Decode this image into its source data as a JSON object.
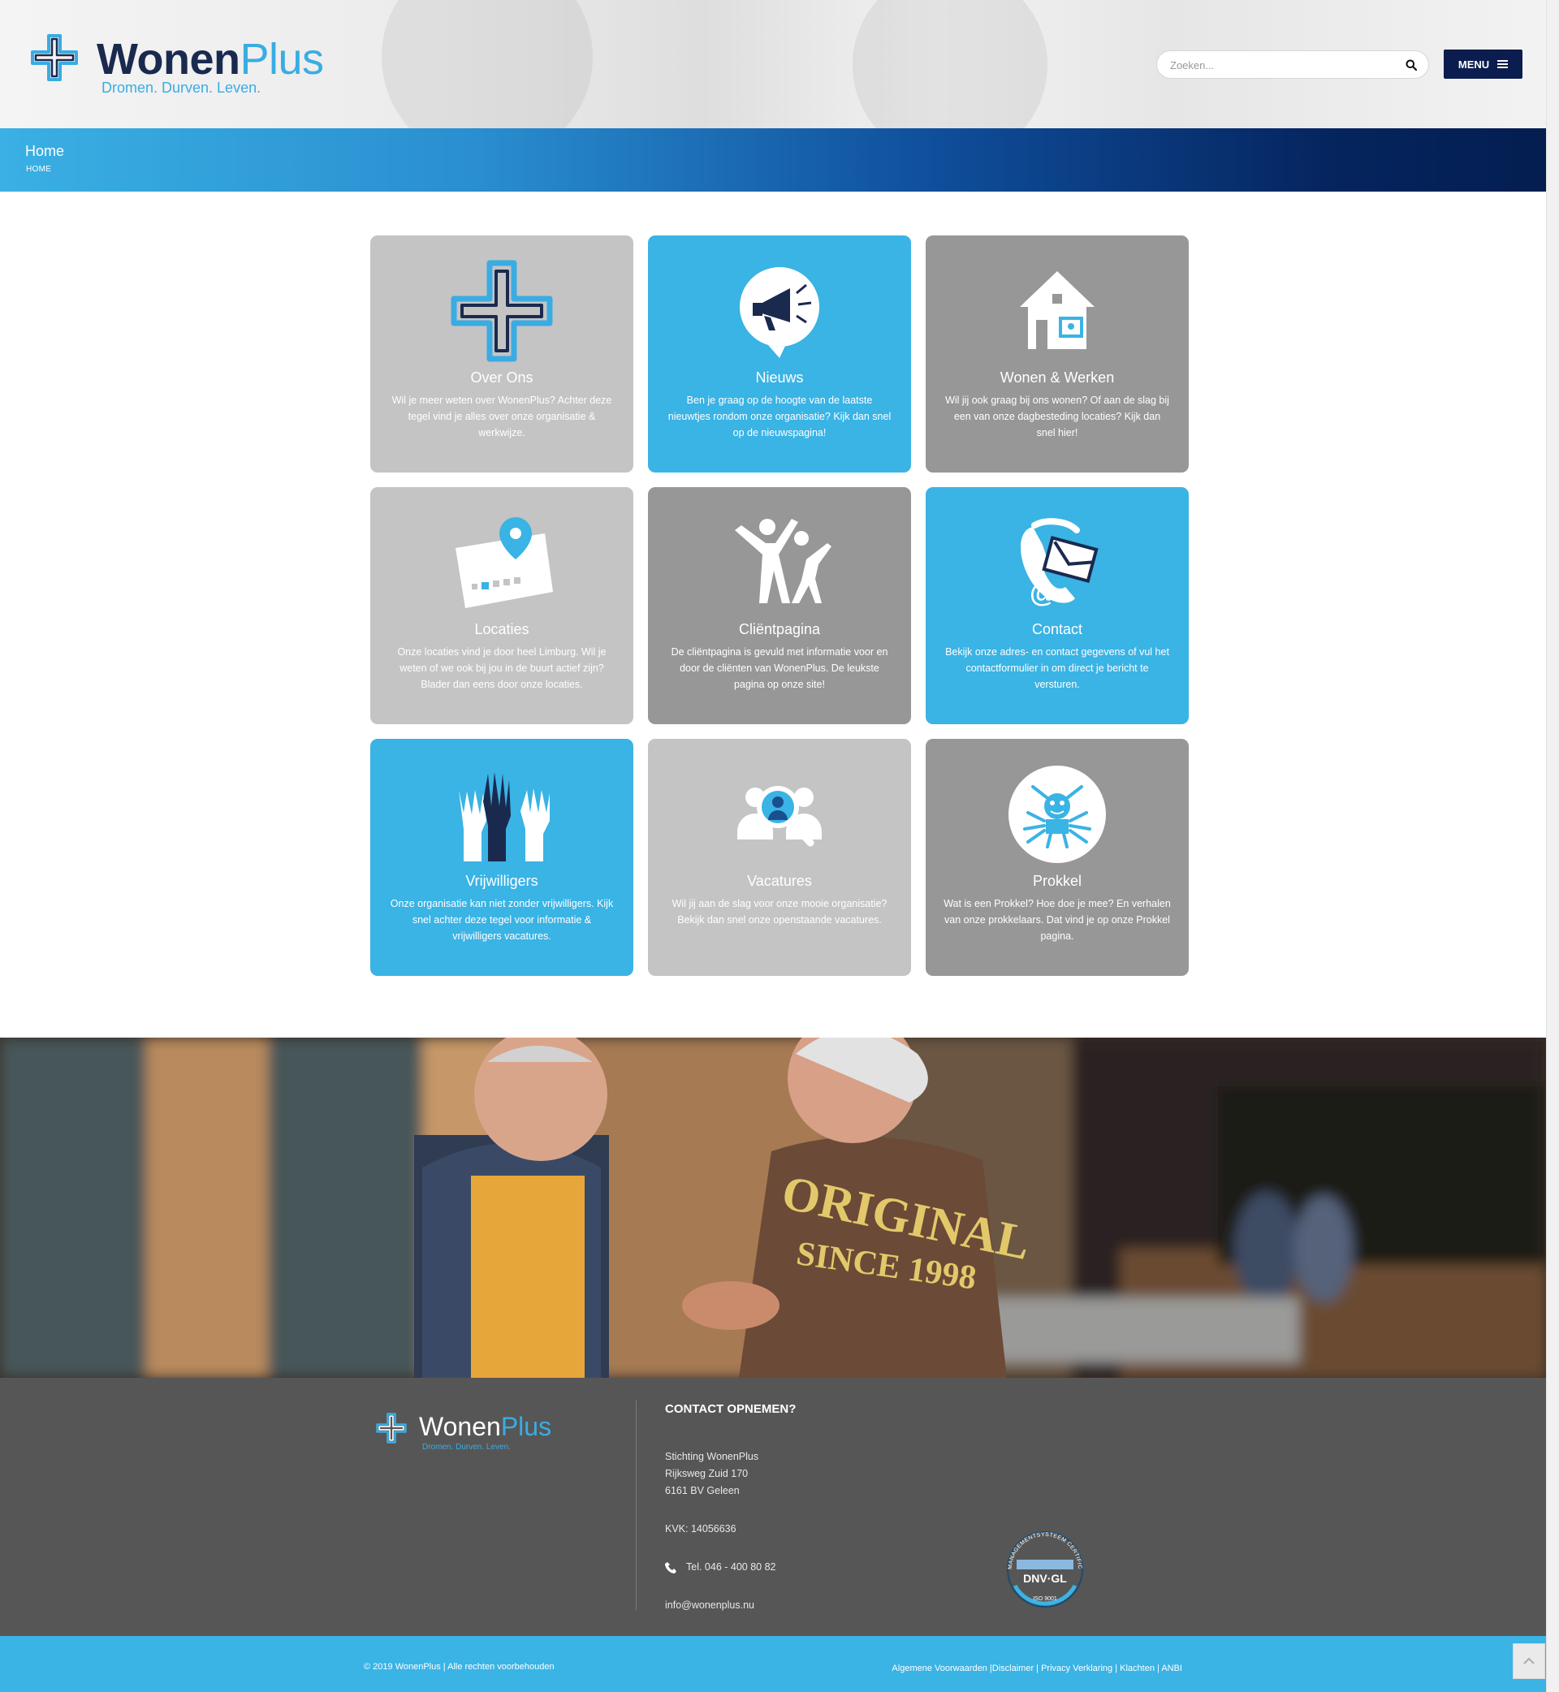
{
  "brand": {
    "name_a": "Wonen",
    "name_b": "Plus",
    "tagline": "Dromen. Durven. Leven."
  },
  "header": {
    "search_placeholder": "Zoeken...",
    "menu_label": "MENU"
  },
  "banner": {
    "title": "Home",
    "breadcrumb": "HOME"
  },
  "tiles": [
    {
      "title": "Over Ons",
      "desc": "Wil je meer weten over WonenPlus? Achter deze tegel vind je alles over onze organisatie & werkwijze.",
      "icon": "cross-logo-icon"
    },
    {
      "title": "Nieuws",
      "desc": "Ben je graag op de hoogte van de laatste nieuwtjes rondom onze organisatie? Kijk dan snel op de nieuwspagina!",
      "icon": "megaphone-icon"
    },
    {
      "title": "Wonen & Werken",
      "desc": "Wil jij ook graag bij ons wonen? Of aan de slag bij een van onze dagbesteding locaties? Kijk dan snel hier!",
      "icon": "house-icon"
    },
    {
      "title": "Locaties",
      "desc": "Onze locaties vind je door heel Limburg. Wil je weten of we ook bij jou in de buurt actief zijn? Blader dan eens door onze locaties.",
      "icon": "map-pin-icon"
    },
    {
      "title": "Cliëntpagina",
      "desc": "De cliëntpagina is gevuld met informatie voor en door de cliënten van WonenPlus. De leukste pagina op onze site!",
      "icon": "people-cheering-icon"
    },
    {
      "title": "Contact",
      "desc": "Bekijk onze adres- en contact gegevens of vul het contactformulier in om direct je bericht te versturen.",
      "icon": "phone-mail-icon"
    },
    {
      "title": "Vrijwilligers",
      "desc": "Onze organisatie kan niet zonder vrijwilligers. Kijk snel achter deze tegel voor informatie & vrijwilligers vacatures.",
      "icon": "raised-hands-icon"
    },
    {
      "title": "Vacatures",
      "desc": "Wil jij aan de slag voor onze mooie organisatie? Bekijk dan snel onze openstaande vacatures.",
      "icon": "magnifier-people-icon"
    },
    {
      "title": "Prokkel",
      "desc": "Wat is een Prokkel? Hoe doe je mee? En verhalen van onze prokkelaars. Dat vind je op onze Prokkel pagina.",
      "icon": "prokkel-frog-icon"
    }
  ],
  "footer": {
    "contact_heading": "CONTACT OPNEMEN?",
    "org": "Stichting WonenPlus",
    "street": "Rijksweg Zuid 170",
    "city": "6161 BV Geleen",
    "kvk": "KVK: 14056636",
    "tel": "Tel. 046 - 400 80 82",
    "email": "info@wonenplus.nu",
    "cert_top": "MANAGEMENTSYSTEEM CERTIFICATE",
    "cert_mid": "DNV·GL",
    "cert_bottom": "ISO 9001"
  },
  "bottom": {
    "copyright": "© 2019 WonenPlus | Alle rechten voorbehouden",
    "links": [
      "Algemene Voorwaarden",
      "Disclaimer",
      "Privacy Verklaring",
      "Klachten",
      "ANBI"
    ]
  },
  "colors": {
    "navy": "#1a2a4f",
    "accent": "#3ab3e5",
    "tile_grey_light": "#c4c4c4",
    "tile_grey_dark": "#979797",
    "footer": "#565656"
  }
}
